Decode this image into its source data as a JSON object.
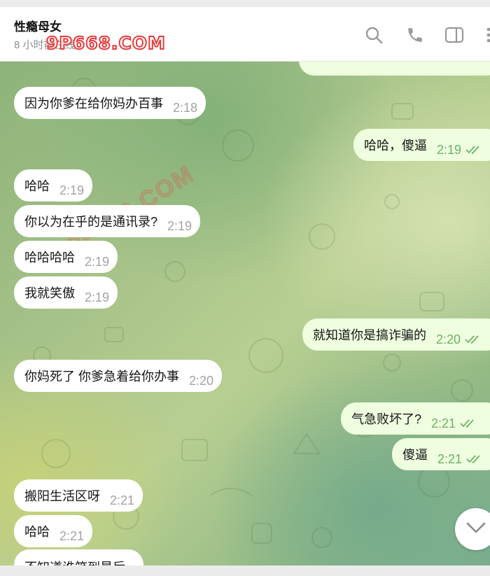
{
  "header": {
    "title": "性瘾母女",
    "status": "8 小时前在线",
    "watermark": "9P668.COM"
  },
  "chat_watermark": "9P668.COM",
  "messages": [
    {
      "dir": "out",
      "text": "",
      "time": ""
    },
    {
      "dir": "in",
      "text": "因为你爹在给你妈办百事",
      "time": "2:18"
    },
    {
      "dir": "out",
      "text": "哈哈，傻逼",
      "time": "2:19"
    },
    {
      "dir": "in",
      "text": "哈哈",
      "time": "2:19"
    },
    {
      "dir": "in",
      "text": "你以为在乎的是通讯录?",
      "time": "2:19"
    },
    {
      "dir": "in",
      "text": "哈哈哈哈",
      "time": "2:19"
    },
    {
      "dir": "in",
      "text": "我就笑傲",
      "time": "2:19"
    },
    {
      "dir": "out",
      "text": "就知道你是搞诈骗的",
      "time": "2:20"
    },
    {
      "dir": "in",
      "text": "你妈死了   你爹急着给你办事",
      "time": "2:20"
    },
    {
      "dir": "out",
      "text": "气急败坏了?",
      "time": "2:21"
    },
    {
      "dir": "out",
      "text": "傻逼",
      "time": "2:21"
    },
    {
      "dir": "in",
      "text": "搬阳生活区呀",
      "time": "2:21"
    },
    {
      "dir": "in",
      "text": "哈哈",
      "time": "2:21"
    },
    {
      "dir": "in",
      "text": "不知道谁笑到最后",
      "time": ""
    }
  ],
  "colors": {
    "outgoing": "#eefedf",
    "incoming": "#ffffff",
    "check": "#6db266",
    "header_icons": "#9a9a9a"
  },
  "icons": [
    "search-icon",
    "phone-icon",
    "sidebar-toggle-icon",
    "more-icon",
    "double-check-icon",
    "chevron-down-icon"
  ]
}
